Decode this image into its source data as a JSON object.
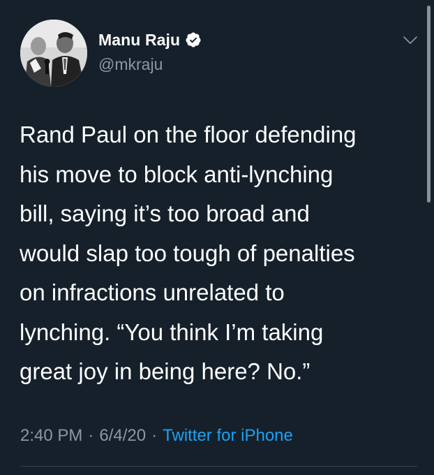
{
  "tweet": {
    "author": {
      "display_name": "Manu Raju",
      "handle": "@mkraju",
      "verified": true
    },
    "text_lines": [
      "Rand Paul on the floor defending",
      "his move to block anti-lynching",
      "bill, saying it’s too broad and",
      "would slap too tough of penalties",
      "on infractions unrelated to",
      "lynching. “You think I’m taking",
      "great joy in being here? No.”"
    ],
    "meta": {
      "time": "2:40 PM",
      "separator": "·",
      "date": "6/4/20",
      "source": "Twitter for iPhone"
    }
  },
  "icons": {
    "verified": "verified-badge-icon",
    "menu": "chevron-down-icon"
  },
  "colors": {
    "background": "#15202b",
    "text_primary": "#ffffff",
    "text_secondary": "#8899a6",
    "accent": "#1da1f2",
    "divider": "#38444d"
  }
}
